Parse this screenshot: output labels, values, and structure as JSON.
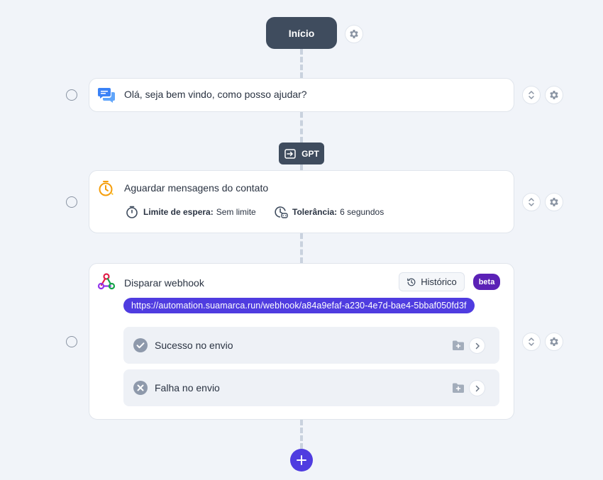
{
  "start": {
    "label": "Início"
  },
  "message_step": {
    "text": "Olá, seja bem vindo, como posso ajudar?"
  },
  "gpt_tag": {
    "label": "GPT"
  },
  "wait_step": {
    "title": "Aguardar mensagens do contato",
    "limit_label": "Limite de espera:",
    "limit_value": "Sem limite",
    "tolerance_label": "Tolerância:",
    "tolerance_value": "6 segundos"
  },
  "webhook_step": {
    "title": "Disparar webhook",
    "history_label": "Histórico",
    "beta_label": "beta",
    "url": "https://automation.suamarca.run/webhook/a84a9efaf-a230-4e7d-bae4-5bbaf050fd3f",
    "branches": [
      {
        "label": "Sucesso no envio",
        "icon": "check-circle-icon"
      },
      {
        "label": "Falha no envio",
        "icon": "x-circle-icon"
      }
    ]
  },
  "colors": {
    "background": "#f1f4f9",
    "dark_pill": "#3f4c5e",
    "accent": "#4f3ce0",
    "beta": "#5b21b6"
  }
}
